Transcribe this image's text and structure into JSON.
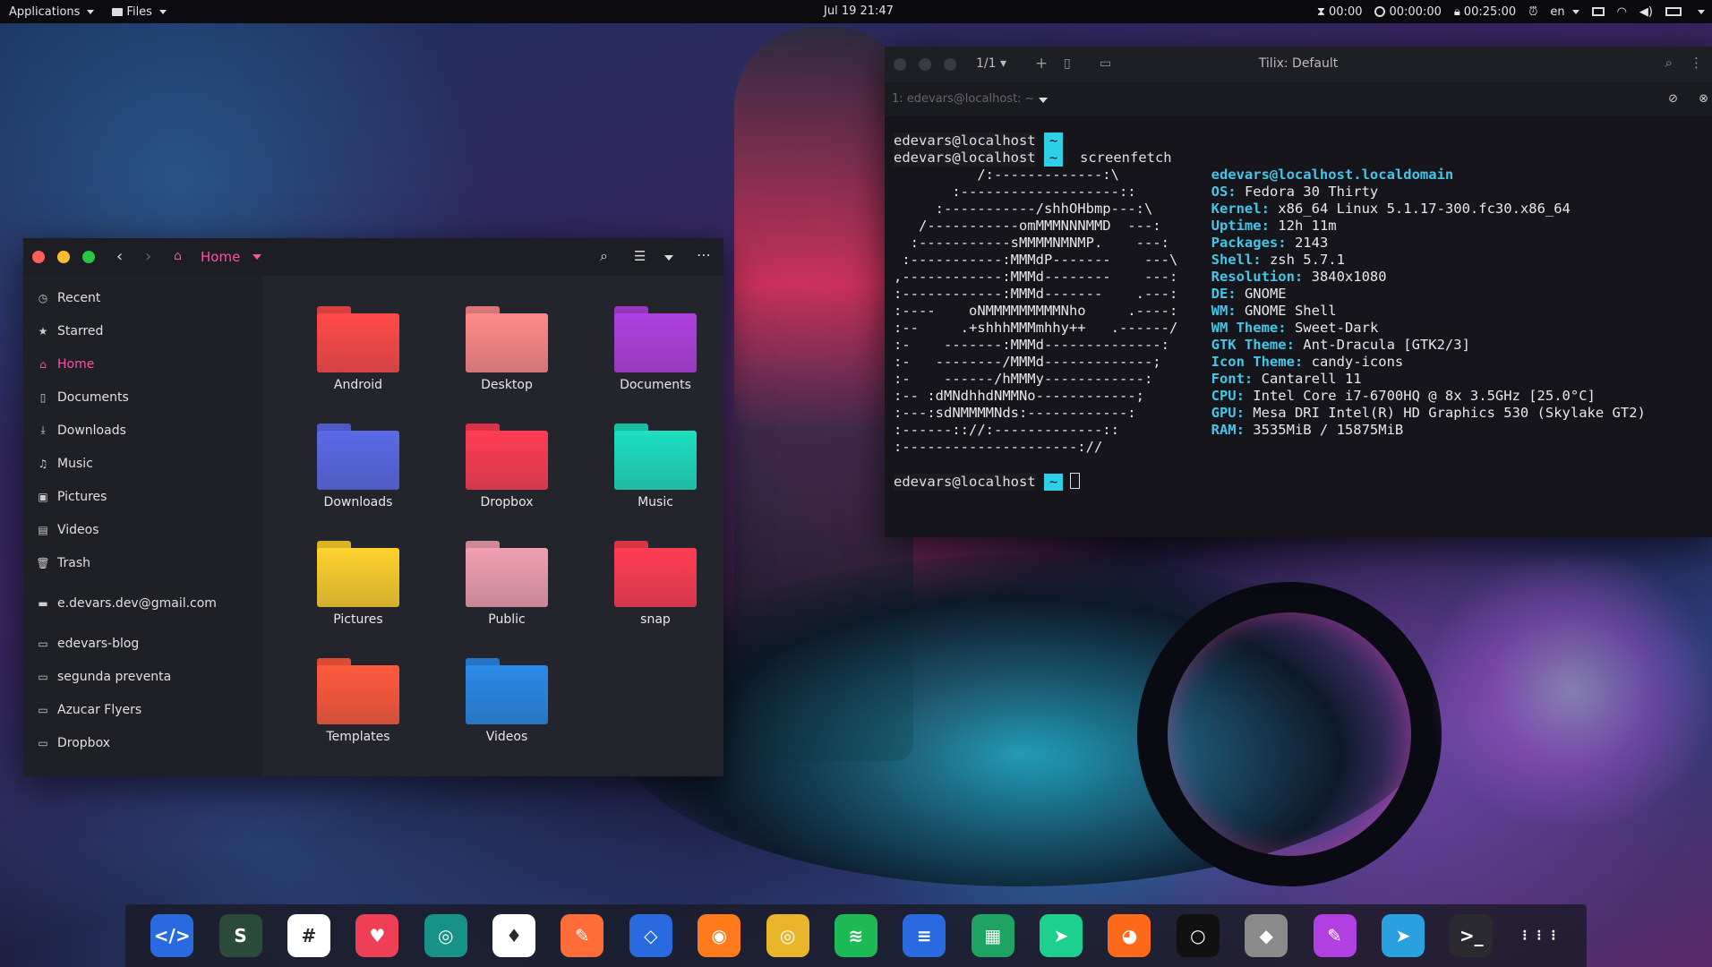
{
  "topbar": {
    "applications": "Applications",
    "files": "Files",
    "datetime": "Jul 19  21:47",
    "timer1": "00:00",
    "timer2": "00:00:00",
    "timer3": "00:25:00",
    "lang": "en"
  },
  "filemanager": {
    "location": "Home",
    "sidebar": [
      {
        "label": "Recent",
        "icon": "clock-icon"
      },
      {
        "label": "Starred",
        "icon": "star-icon"
      },
      {
        "label": "Home",
        "icon": "home-icon"
      },
      {
        "label": "Documents",
        "icon": "document-icon"
      },
      {
        "label": "Downloads",
        "icon": "download-icon"
      },
      {
        "label": "Music",
        "icon": "music-icon"
      },
      {
        "label": "Pictures",
        "icon": "picture-icon"
      },
      {
        "label": "Videos",
        "icon": "video-icon"
      },
      {
        "label": "Trash",
        "icon": "trash-icon"
      }
    ],
    "account": "e.devars.dev@gmail.com",
    "bookmarks": [
      "edevars-blog",
      "segunda preventa",
      "Azucar Flyers",
      "Dropbox"
    ],
    "folders": [
      {
        "name": "Android",
        "color": "#ff4a4a"
      },
      {
        "name": "Desktop",
        "color": "#ff8a8a"
      },
      {
        "name": "Documents",
        "color": "#b040e0"
      },
      {
        "name": "Downloads",
        "color": "#5a6ae8"
      },
      {
        "name": "Dropbox",
        "color": "#ff3d55"
      },
      {
        "name": "Music",
        "color": "#1ee0c0"
      },
      {
        "name": "Pictures",
        "color": "#ffd22e"
      },
      {
        "name": "Public",
        "color": "#f0a0b0"
      },
      {
        "name": "snap",
        "color": "#ff3d55"
      },
      {
        "name": "Templates",
        "color": "#ff5a3c"
      },
      {
        "name": "Videos",
        "color": "#2a8ae8"
      }
    ]
  },
  "terminal": {
    "title": "Tilix: Default",
    "session_count": "1/1",
    "tab_label": "1: edevars@localhost: ~",
    "user": "edevars@localhost",
    "tilde": "~",
    "command": "screenfetch",
    "ascii": [
      "          /:-------------:\\",
      "       :-------------------::",
      "     :-----------/shhOHbmp---:\\",
      "   /-----------omMMMNNNMMD  ---:",
      "  :-----------sMMMMNMNMP.    ---:",
      " :-----------:MMMdP-------    ---\\",
      ",------------:MMMd--------    ---:",
      ":------------:MMMd-------    .---:",
      ":----    oNMMMMMMMMMNho     .----:",
      ":--     .+shhhMMMmhhy++   .------/",
      ":-    -------:MMMd--------------:",
      ":-   --------/MMMd-------------;",
      ":-    ------/hMMMy------------:",
      ":-- :dMNdhhdNMMNo------------;",
      ":---:sdNMMMMNds:------------:",
      ":------:://:-------------::",
      ":---------------------://"
    ],
    "info": [
      {
        "key": "",
        "value": "edevars@localhost.localdomain"
      },
      {
        "key": "OS:",
        "value": "Fedora 30 Thirty"
      },
      {
        "key": "Kernel:",
        "value": "x86_64 Linux 5.1.17-300.fc30.x86_64"
      },
      {
        "key": "Uptime:",
        "value": "12h 11m"
      },
      {
        "key": "Packages:",
        "value": "2143"
      },
      {
        "key": "Shell:",
        "value": "zsh 5.7.1"
      },
      {
        "key": "Resolution:",
        "value": "3840x1080"
      },
      {
        "key": "DE:",
        "value": "GNOME"
      },
      {
        "key": "WM:",
        "value": "GNOME Shell"
      },
      {
        "key": "WM Theme:",
        "value": "Sweet-Dark"
      },
      {
        "key": "GTK Theme:",
        "value": "Ant-Dracula [GTK2/3]"
      },
      {
        "key": "Icon Theme:",
        "value": "candy-icons"
      },
      {
        "key": "Font:",
        "value": "Cantarell 11"
      },
      {
        "key": "CPU:",
        "value": "Intel Core i7-6700HQ @ 8x 3.5GHz [25.0°C]"
      },
      {
        "key": "GPU:",
        "value": "Mesa DRI Intel(R) HD Graphics 530 (Skylake GT2)"
      },
      {
        "key": "RAM:",
        "value": "3535MiB / 15875MiB"
      }
    ]
  },
  "dock": [
    {
      "name": "files",
      "color": "#2a6ae0",
      "glyph": "</>"
    },
    {
      "name": "sublime",
      "color": "#2a4a3a",
      "glyph": "S"
    },
    {
      "name": "slack",
      "color": "#ffffff",
      "glyph": "#"
    },
    {
      "name": "pocket",
      "color": "#ef3f56",
      "glyph": "♥"
    },
    {
      "name": "gitkraken",
      "color": "#179287",
      "glyph": "◎"
    },
    {
      "name": "mongodb",
      "color": "#ffffff",
      "glyph": "♦"
    },
    {
      "name": "postman",
      "color": "#ff6c37",
      "glyph": "✎"
    },
    {
      "name": "vscode",
      "color": "#2a6ae0",
      "glyph": "◇"
    },
    {
      "name": "firefox",
      "color": "#ff7a1a",
      "glyph": "◉"
    },
    {
      "name": "chrome",
      "color": "#e8b42a",
      "glyph": "◎"
    },
    {
      "name": "spotify",
      "color": "#1db954",
      "glyph": "≋"
    },
    {
      "name": "docs",
      "color": "#2a6ae0",
      "glyph": "≡"
    },
    {
      "name": "sheets",
      "color": "#1ea362",
      "glyph": "▦"
    },
    {
      "name": "migrate",
      "color": "#1ed090",
      "glyph": "➤"
    },
    {
      "name": "gimp",
      "color": "#ff6a1a",
      "glyph": "◕"
    },
    {
      "name": "circle",
      "color": "#111111",
      "glyph": "○"
    },
    {
      "name": "inkscape",
      "color": "#8a8a8a",
      "glyph": "◆"
    },
    {
      "name": "paint",
      "color": "#b040e0",
      "glyph": "✎"
    },
    {
      "name": "telegram",
      "color": "#2aa0e0",
      "glyph": "➤"
    },
    {
      "name": "terminal",
      "color": "#2a2a30",
      "glyph": ">_"
    },
    {
      "name": "app-grid",
      "color": "transparent",
      "glyph": "⋮⋮⋮"
    }
  ]
}
